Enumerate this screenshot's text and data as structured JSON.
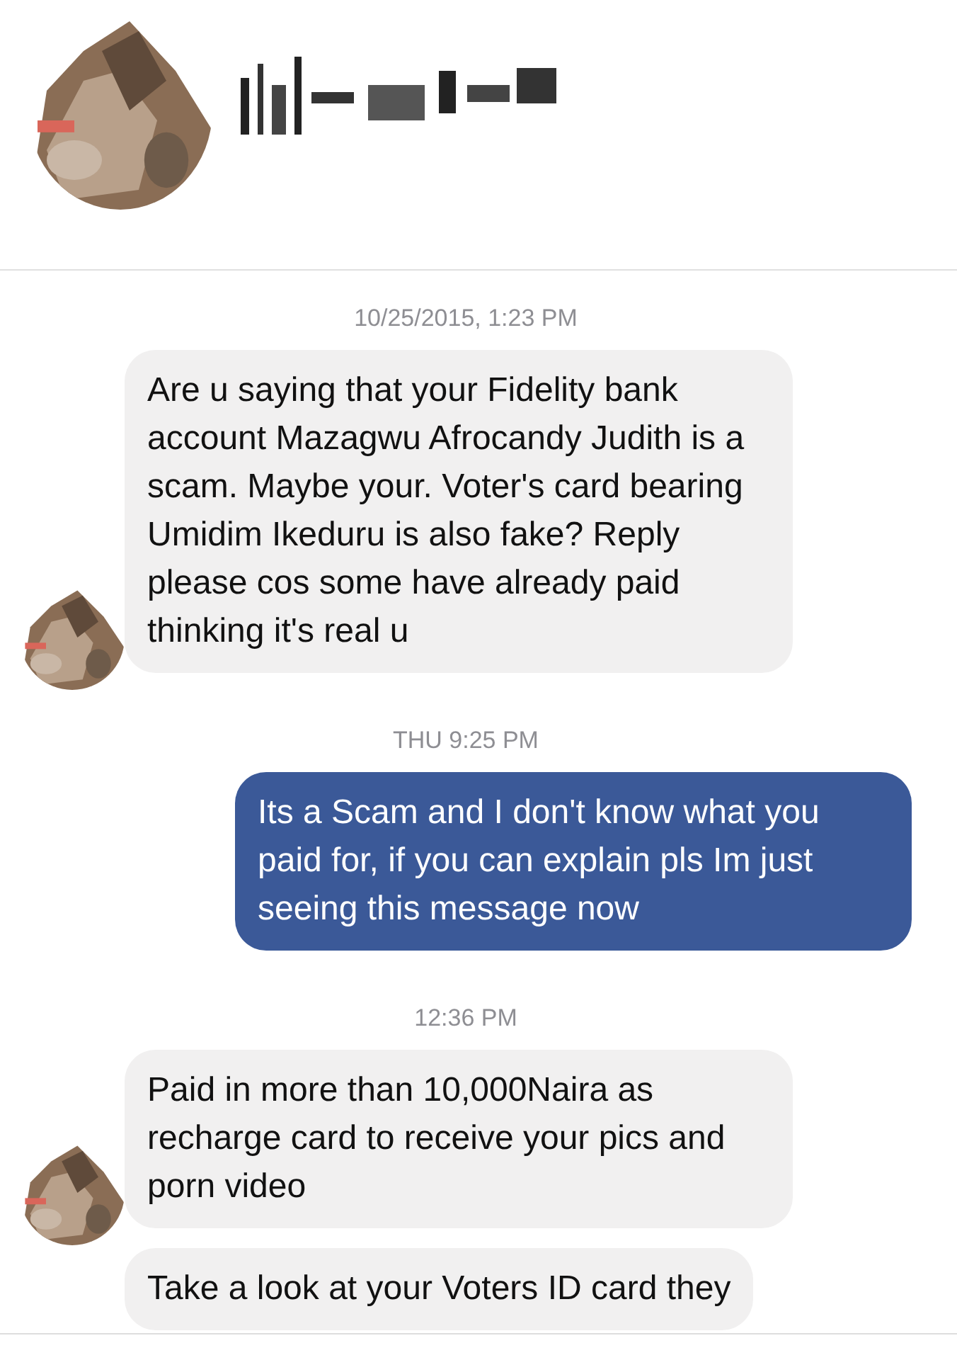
{
  "messages": [
    {
      "kind": "timestamp",
      "text": "10/25/2015, 1:23 PM"
    },
    {
      "kind": "received",
      "avatar": true,
      "text": "Are u saying that your Fidelity bank account Mazagwu Afrocandy Judith is a scam. Maybe your. Voter's card bearing Umidim Ikeduru is also fake? Reply please cos some have already paid thinking it's real u"
    },
    {
      "kind": "timestamp",
      "text": "THU 9:25 PM"
    },
    {
      "kind": "sent",
      "text": "Its a Scam and I don't know what you paid for, if you can explain pls Im just seeing this message now"
    },
    {
      "kind": "timestamp",
      "text": "12:36 PM"
    },
    {
      "kind": "received",
      "avatar": true,
      "text": "Paid in more than 10,000Naira as recharge card to receive your pics and porn video"
    },
    {
      "kind": "received",
      "avatar": false,
      "text": "Take a look at your Voters ID card they"
    }
  ]
}
